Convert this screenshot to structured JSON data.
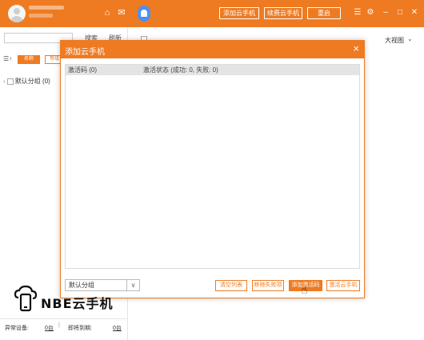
{
  "header": {
    "buttons": [
      "添加云手机",
      "续费云手机",
      "重启"
    ]
  },
  "left_panel": {
    "search_link": "搜索",
    "refresh_link": "刷新",
    "tabs": [
      "名称",
      "等级"
    ],
    "tree_item": "默认分组",
    "tree_count": "(0)",
    "bottom": {
      "abnormal_label": "异常设备:",
      "abnormal_value": "0台",
      "expiring_label": "即将到期:",
      "expiring_value": "0台"
    }
  },
  "right_panel": {
    "view_label": "大视图"
  },
  "modal": {
    "title": "添加云手机",
    "close": "×",
    "table_headers": [
      "激活码 (0)",
      "激活状态 (成功: 0, 失败: 0)"
    ],
    "group_value": "默认分组",
    "buttons": [
      "清空列表",
      "移除失败项",
      "添加激活码",
      "激活云手机"
    ]
  },
  "watermark": {
    "text": "NBE云手机"
  },
  "colors": {
    "accent": "#ee7b22",
    "bell": "#4f8ff0"
  }
}
